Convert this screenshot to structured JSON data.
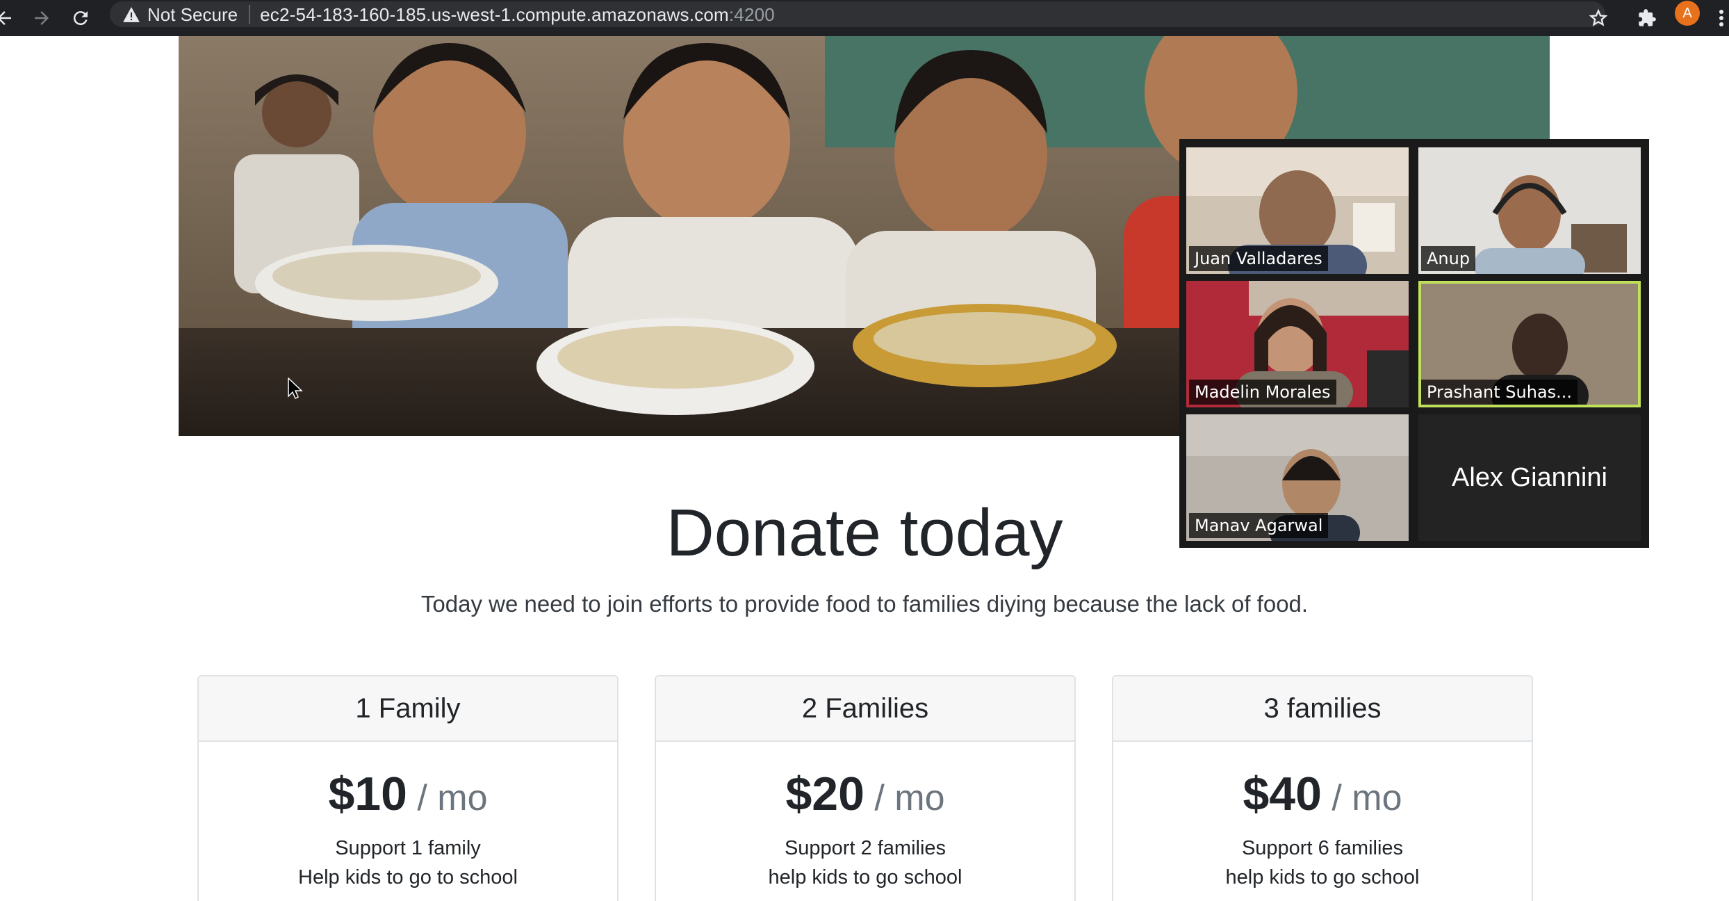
{
  "browser": {
    "security_label": "Not Secure",
    "url_host": "ec2-54-183-160-185.us-west-1.compute.amazonaws.com",
    "url_port": ":4200",
    "profile_initial": "A"
  },
  "hero": {
    "image_description": "children smiling with bowls of food"
  },
  "meeting": {
    "participants": [
      {
        "name": "Juan Valladares",
        "video": true
      },
      {
        "name": "Anup",
        "video": true
      },
      {
        "name": "Madelin Morales",
        "video": true
      },
      {
        "name": "Prashant Suhas...",
        "video": true,
        "active_speaker": true
      },
      {
        "name": "Manav Agarwal",
        "video": true
      },
      {
        "name": "Alex Giannini",
        "video": false
      }
    ]
  },
  "donate": {
    "title": "Donate today",
    "lead": "Today we need to join efforts to provide food to families diying because the lack of food."
  },
  "plans": [
    {
      "header": "1 Family",
      "price": "$10",
      "period": " / mo",
      "features": [
        "Support 1 family",
        "Help kids to go to school"
      ]
    },
    {
      "header": "2 Families",
      "price": "$20",
      "period": " / mo",
      "features": [
        "Support 2 families",
        "help kids to go school"
      ]
    },
    {
      "header": "3 families",
      "price": "$40",
      "period": " / mo",
      "features": [
        "Support 6 families",
        "help kids to go school"
      ]
    }
  ],
  "colors": {
    "toolbar_bg": "#202124",
    "active_speaker_outline": "#bfe05a",
    "profile_badge": "#e8711c"
  }
}
